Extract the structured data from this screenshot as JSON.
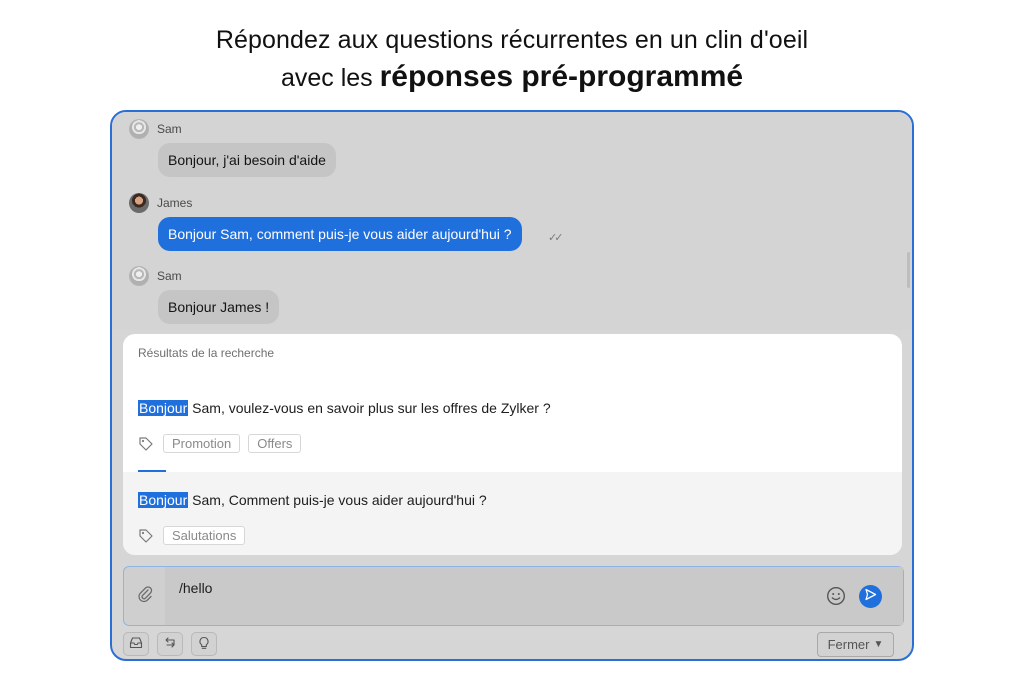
{
  "headline": {
    "line1": "Répondez aux questions récurrentes en un clin d'oeil",
    "line2_prefix": "avec les ",
    "line2_strong": "réponses pré-programmé"
  },
  "chat": {
    "messages": [
      {
        "sender": "Sam",
        "text": "Bonjour, j'ai besoin d'aide",
        "direction": "incoming"
      },
      {
        "sender": "James",
        "text": "Bonjour Sam, comment puis-je vous aider aujourd'hui ?",
        "direction": "outgoing",
        "status": "read"
      },
      {
        "sender": "Sam",
        "text": "Bonjour James !",
        "direction": "incoming"
      }
    ]
  },
  "search_results": {
    "title": "Résultats de la recherche",
    "items": [
      {
        "highlight": "Bonjour",
        "rest": " Sam, voulez-vous en savoir plus sur les offres de Zylker ?",
        "tags": [
          "Promotion",
          "Offers"
        ]
      },
      {
        "highlight": "Bonjour",
        "rest": " Sam, Comment puis-je vous aider aujourd'hui ?",
        "tags": [
          "Salutations"
        ]
      }
    ]
  },
  "composer": {
    "value": "/hello"
  },
  "footer": {
    "close_label": "Fermer"
  },
  "colors": {
    "accent": "#1f6fdc",
    "frame_border": "#2a6fd6",
    "overlay_gray": "#d4d4d4"
  },
  "icons": [
    "paperclip-icon",
    "emoji-icon",
    "send-icon",
    "tag-icon",
    "inbox-icon",
    "transfer-icon",
    "lightbulb-icon",
    "chevron-down-icon",
    "read-receipt-icon"
  ]
}
